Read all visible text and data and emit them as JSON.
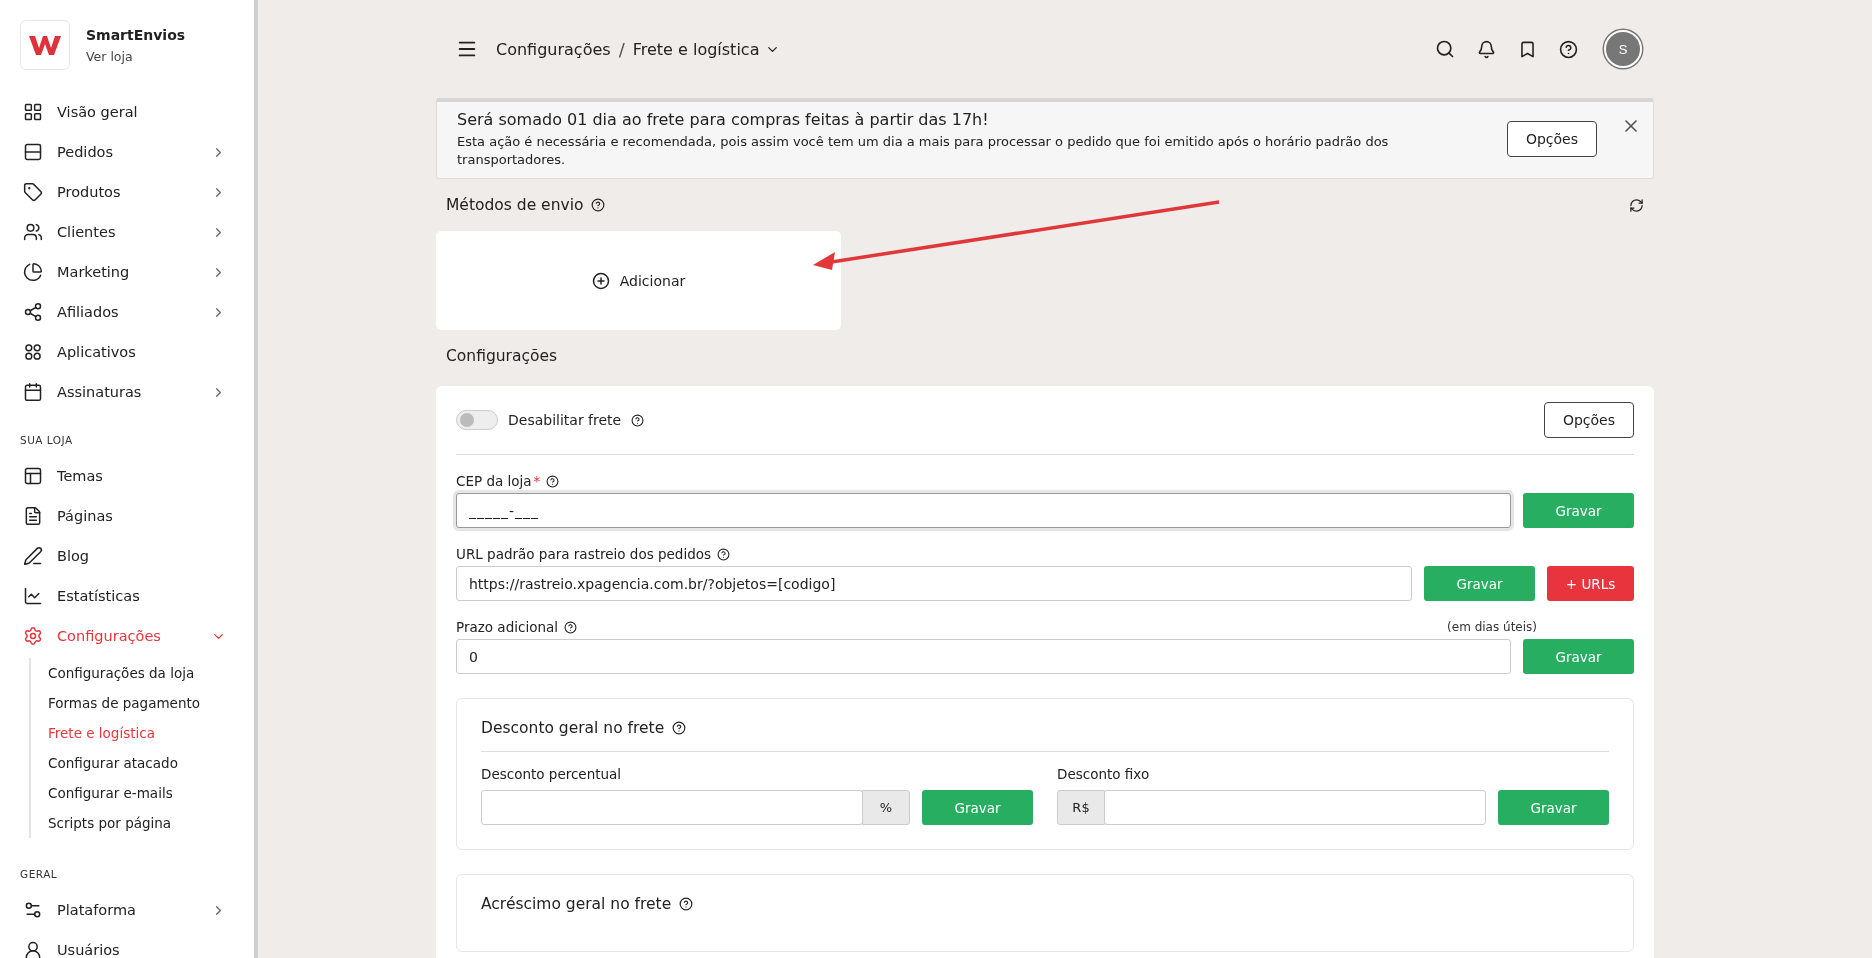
{
  "sidebar": {
    "store_name": "SmartEnvios",
    "store_link": "Ver loja",
    "sections": [
      {
        "items": [
          {
            "label": "Visão geral",
            "has_submenu": false,
            "selected": false
          },
          {
            "label": "Pedidos",
            "has_submenu": true,
            "selected": false
          },
          {
            "label": "Produtos",
            "has_submenu": true,
            "selected": false
          },
          {
            "label": "Clientes",
            "has_submenu": true,
            "selected": false
          },
          {
            "label": "Marketing",
            "has_submenu": true,
            "selected": false
          },
          {
            "label": "Afiliados",
            "has_submenu": true,
            "selected": false
          },
          {
            "label": "Aplicativos",
            "has_submenu": false,
            "selected": false
          },
          {
            "label": "Assinaturas",
            "has_submenu": true,
            "selected": false
          }
        ]
      },
      {
        "title": "SUA LOJA",
        "items": [
          {
            "label": "Temas",
            "has_submenu": false,
            "selected": false
          },
          {
            "label": "Páginas",
            "has_submenu": false,
            "selected": false
          },
          {
            "label": "Blog",
            "has_submenu": false,
            "selected": false
          },
          {
            "label": "Estatísticas",
            "has_submenu": false,
            "selected": false
          },
          {
            "label": "Configurações",
            "has_submenu": true,
            "selected": true,
            "expanded": true,
            "children": [
              {
                "label": "Configurações da loja",
                "selected": false
              },
              {
                "label": "Formas de pagamento",
                "selected": false
              },
              {
                "label": "Frete e logística",
                "selected": true
              },
              {
                "label": "Configurar atacado",
                "selected": false
              },
              {
                "label": "Configurar e-mails",
                "selected": false
              },
              {
                "label": "Scripts por página",
                "selected": false
              }
            ]
          }
        ]
      },
      {
        "title": "GERAL",
        "items": [
          {
            "label": "Plataforma",
            "has_submenu": true,
            "selected": false
          },
          {
            "label": "Usuários",
            "has_submenu": false,
            "selected": false
          }
        ]
      }
    ]
  },
  "header": {
    "separator": "/",
    "breadcrumb": [
      "Configurações",
      "Frete e logística"
    ],
    "avatar_initial": "S"
  },
  "banner": {
    "title": "Será somado 01 dia ao frete para compras feitas à partir das 17h!",
    "message": "Esta ação é necessária e recomendada, pois assim você tem um dia a mais para processar o pedido que foi emitido após o horário padrão dos transportadores.",
    "button": "Opções"
  },
  "shipping_methods": {
    "title": "Métodos de envio",
    "add_label": "Adicionar"
  },
  "settings": {
    "title": "Configurações",
    "disable_shipping": {
      "label": "Desabilitar frete",
      "on": false
    },
    "options_button": "Opções",
    "fields": [
      {
        "label": "CEP da loja",
        "required_mark": "*",
        "placeholder": "_____-___",
        "focused": true,
        "buttons": [
          {
            "label": "Gravar",
            "kind": "save"
          }
        ]
      },
      {
        "label": "URL padrão para rastreio dos pedidos",
        "value": "https://rastreio.xpagencia.com.br/?objetos=[codigo]",
        "focused": false,
        "buttons": [
          {
            "label": "Gravar",
            "kind": "save"
          },
          {
            "label": "+ URLs",
            "kind": "danger"
          }
        ]
      },
      {
        "label": "Prazo adicional",
        "hint": "(em dias úteis)",
        "value": "0",
        "focused": false,
        "buttons": [
          {
            "label": "Gravar",
            "kind": "save"
          }
        ]
      }
    ],
    "discount": {
      "title": "Desconto geral no frete",
      "fields": [
        {
          "label": "Desconto percentual",
          "suffix": "%",
          "button": "Gravar"
        },
        {
          "label": "Desconto fixo",
          "prefix": "R$",
          "button": "Gravar"
        }
      ]
    },
    "surcharge": {
      "title": "Acréscimo geral no frete"
    }
  }
}
